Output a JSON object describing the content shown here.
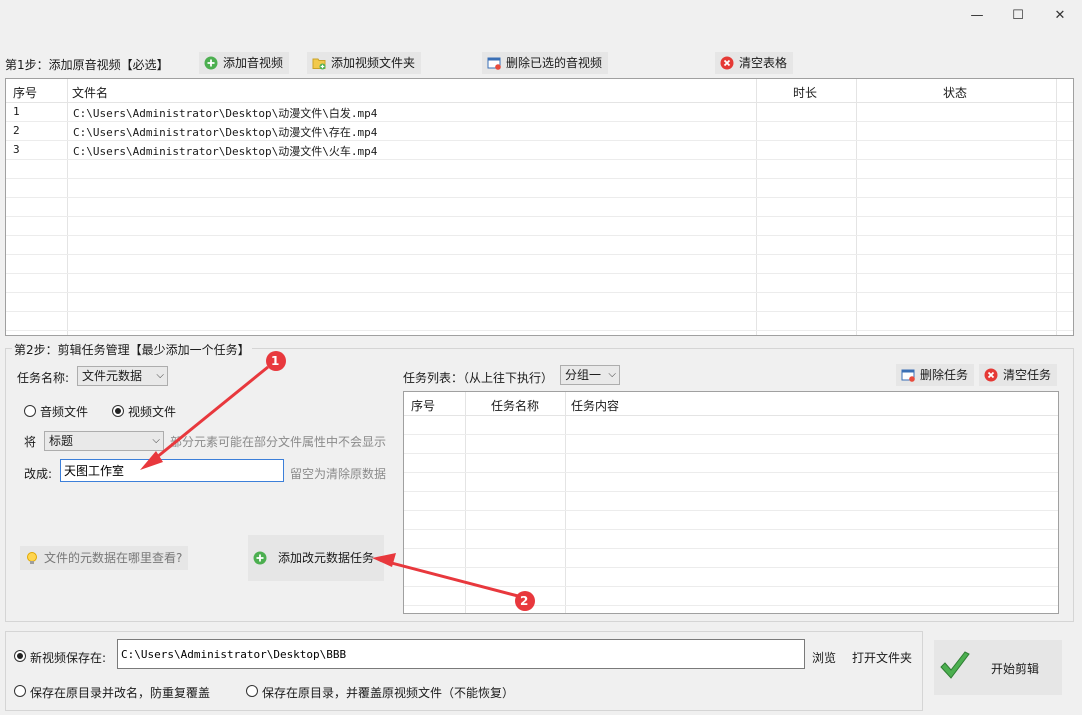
{
  "window": {
    "minimize_icon": "—",
    "maximize_icon": "☐",
    "close_icon": "✕"
  },
  "step1": {
    "label": "第1步：添加原音视频【必选】",
    "buttons": {
      "add_media": "添加音视频",
      "add_folder": "添加视频文件夹",
      "delete_selected": "删除已选的音视频",
      "clear_table": "清空表格"
    },
    "table": {
      "headers": [
        "序号",
        "文件名",
        "时长",
        "状态"
      ],
      "rows": [
        {
          "index": "1",
          "file": "C:\\Users\\Administrator\\Desktop\\动漫文件\\白发.mp4",
          "duration": "",
          "status": ""
        },
        {
          "index": "2",
          "file": "C:\\Users\\Administrator\\Desktop\\动漫文件\\存在.mp4",
          "duration": "",
          "status": ""
        },
        {
          "index": "3",
          "file": "C:\\Users\\Administrator\\Desktop\\动漫文件\\火车.mp4",
          "duration": "",
          "status": ""
        }
      ]
    }
  },
  "step2": {
    "label": "第2步：剪辑任务管理【最少添加一个任务】",
    "task_name_label": "任务名称:",
    "task_name_value": "文件元数据",
    "radio_audio": "音频文件",
    "radio_video": "视频文件",
    "field_prefix": "将",
    "field_value": "标题",
    "field_hint": "部分元素可能在部分文件属性中不会显示",
    "change_to_label": "改成:",
    "change_to_value": "天图工作室",
    "change_to_hint": "留空为清除原数据",
    "metadata_help": "文件的元数据在哪里查看?",
    "add_task_button": "添加改元数据任务",
    "task_list_label": "任务列表：（从上往下执行）",
    "group_value": "分组一",
    "delete_task": "删除任务",
    "clear_tasks": "清空任务",
    "task_headers": [
      "序号",
      "任务名称",
      "任务内容"
    ]
  },
  "annotations": {
    "marker1": "1",
    "marker2": "2",
    "color": "#e8383d"
  },
  "output": {
    "save_new_label": "新视频保存在:",
    "save_path": "C:\\Users\\Administrator\\Desktop\\BBB",
    "browse": "浏览",
    "open_folder": "打开文件夹",
    "option_rename": "保存在原目录并改名，防重复覆盖",
    "option_overwrite": "保存在原目录，并覆盖原视频文件（不能恢复）",
    "start_button": "开始剪辑"
  }
}
